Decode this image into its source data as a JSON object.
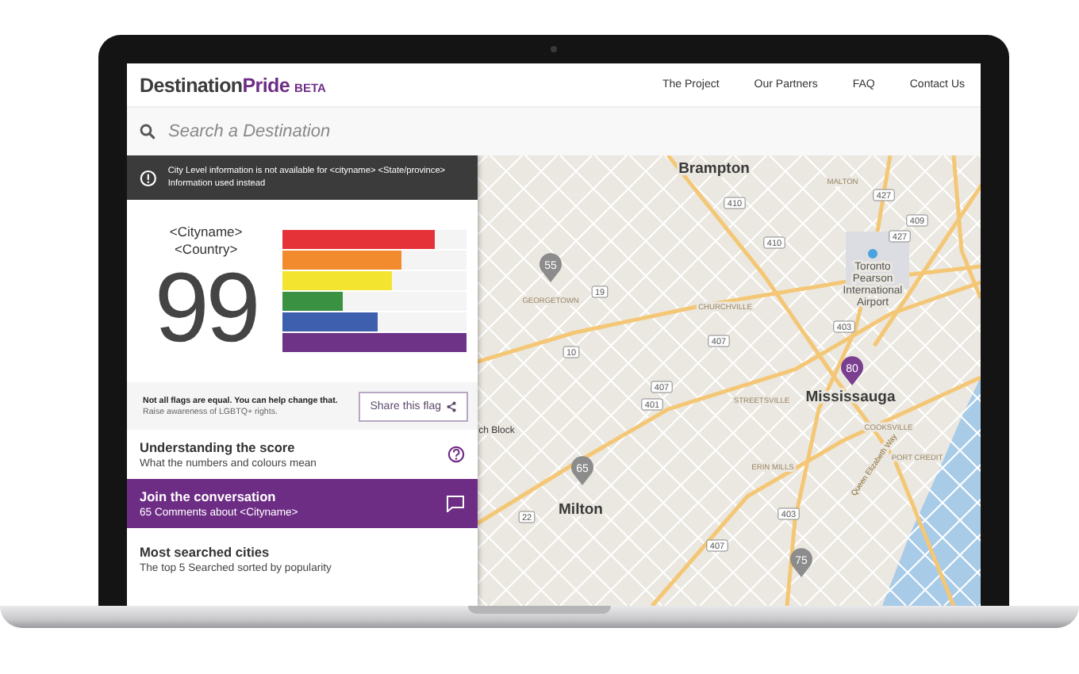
{
  "header": {
    "logo": {
      "name": "Destination",
      "accent": "Pride",
      "badge": "BETA"
    },
    "nav": [
      "The Project",
      "Our Partners",
      "FAQ",
      "Contact Us"
    ]
  },
  "search": {
    "placeholder": "Search a Destination"
  },
  "notice": {
    "text": "City Level information is not available for <cityname> <State/province> Information used instead"
  },
  "score": {
    "city": "<Cityname>",
    "country": "<Country>",
    "value": "99",
    "flag": [
      {
        "color": "#e53238",
        "level": 0.83
      },
      {
        "color": "#f28a2e",
        "level": 0.65
      },
      {
        "color": "#f3e42f",
        "level": 0.6
      },
      {
        "color": "#3a9142",
        "level": 0.33
      },
      {
        "color": "#3d5fae",
        "level": 0.52
      },
      {
        "color": "#6e3386",
        "level": 1.0
      }
    ]
  },
  "share": {
    "headline": "Not all flags are equal. You can help change that.",
    "note": "Raise awareness of LGBTQ+ rights.",
    "button": "Share this flag"
  },
  "sections": [
    {
      "kind": "help",
      "title": "Understanding the score",
      "subtitle": "What the numbers and colours mean",
      "highlighted": false
    },
    {
      "kind": "comments",
      "title": "Join the conversation",
      "subtitle": "65 Comments about <Cityname>",
      "highlighted": true
    },
    {
      "kind": "plain",
      "title": "Most searched cities",
      "subtitle": "The top 5 Searched sorted by popularity",
      "highlighted": false
    }
  ],
  "map": {
    "labels": [
      {
        "kind": "city",
        "text": "Brampton"
      },
      {
        "kind": "airport",
        "text": "Toronto Pearson International Airport"
      },
      {
        "kind": "city",
        "text": "Mississauga"
      },
      {
        "kind": "city",
        "text": "Milton"
      },
      {
        "kind": "area",
        "text": "GEORGETOWN"
      },
      {
        "kind": "area",
        "text": "CHURCHVILLE"
      },
      {
        "kind": "area",
        "text": "MALTON"
      },
      {
        "kind": "area",
        "text": "STREETSVILLE"
      },
      {
        "kind": "area",
        "text": "COOKSVILLE"
      },
      {
        "kind": "area",
        "text": "PORT CREDIT"
      },
      {
        "kind": "area",
        "text": "ERIN MILLS"
      },
      {
        "kind": "city",
        "text": "ch Block"
      },
      {
        "kind": "road",
        "text": "Queen Elizabeth Way"
      }
    ],
    "shields": [
      "410",
      "410",
      "427",
      "427",
      "409",
      "403",
      "407",
      "10",
      "19",
      "401",
      "407",
      "403",
      "407",
      "22"
    ],
    "pins": [
      {
        "value": "55",
        "color": "#8c8c8c"
      },
      {
        "value": "80",
        "color": "#7b3f8f"
      },
      {
        "value": "65",
        "color": "#8c8c8c"
      },
      {
        "value": "75",
        "color": "#8c8c8c"
      }
    ]
  }
}
